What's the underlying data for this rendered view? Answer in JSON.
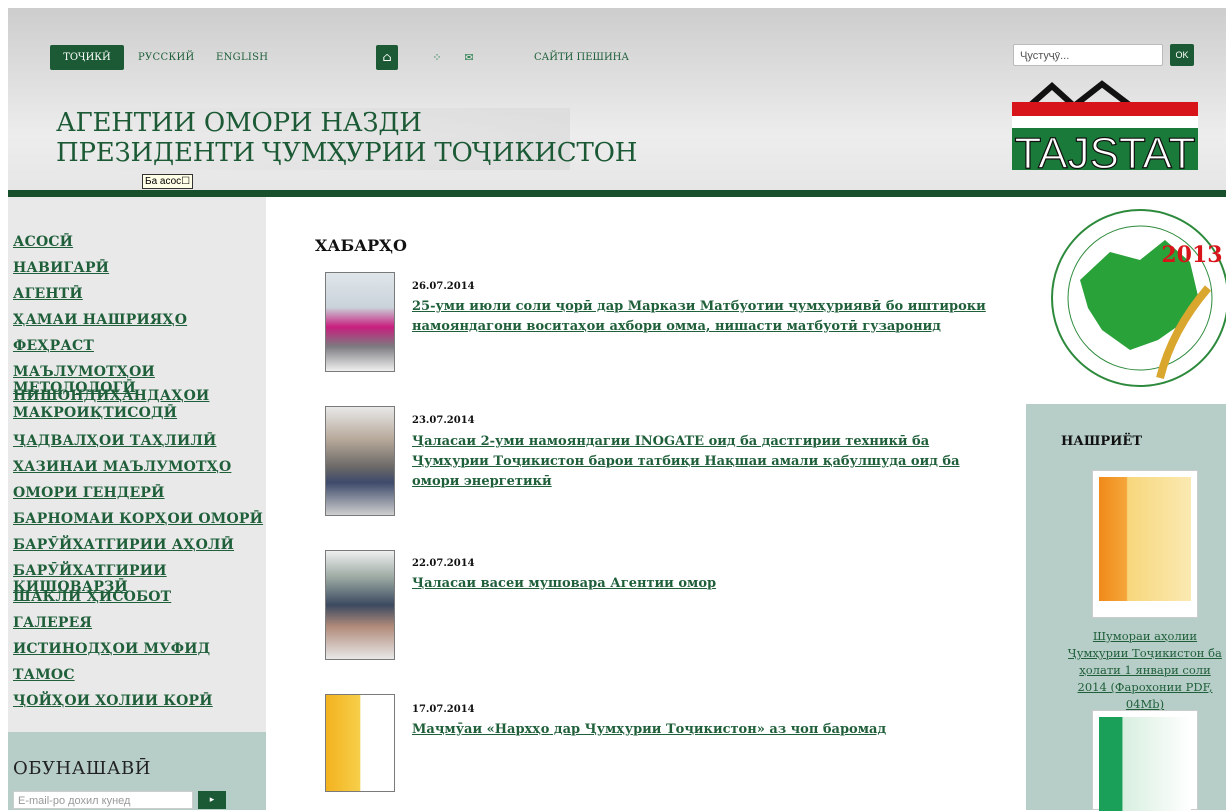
{
  "header": {
    "languages": [
      {
        "label": "ТОҶИКӢ",
        "active": true
      },
      {
        "label": "РУССКИЙ",
        "active": false
      },
      {
        "label": "ENGLISH",
        "active": false
      }
    ],
    "icons": [
      "home-icon",
      "sitemap-icon",
      "mail-icon"
    ],
    "old_site_label": "САЙТИ ПЕШИНА",
    "search": {
      "placeholder": "Ҷустуҷӯ...",
      "button_label": "OK"
    },
    "title_line1": "АГЕНТИИ ОМОРИ НАЗДИ",
    "title_line2": "ПРЕЗИДЕНТИ ҶУМҲУРИИ ТОҶИКИСТОН",
    "tooltip": "Ба асос",
    "logo_text": "TAJSTAT",
    "colors": {
      "brand_green": "#1b5a35",
      "logo_red": "#d7141a"
    }
  },
  "sidebar": {
    "items": [
      "АСОСӢ",
      "НАВИГАРӢ",
      "АГЕНТӢ",
      "ҲАМАИ НАШРИЯҲО",
      "ФЕҲРАСТ",
      "МАЪЛУМОТҲОИ МЕТОДОЛОГӢ",
      "НИШОНДИҲАНДАҲОИ МАКРОИҚТИСОДӢ",
      "ҶАДВАЛҲОИ ТАҲЛИЛӢ",
      "ХАЗИНАИ МАЪЛУМОТҲО",
      "ОМОРИ ГЕНДЕРӢ",
      "БАРНОМАИ КОРҲОИ ОМОРӢ",
      "БАРӮЙХАТГИРИИ АҲОЛӢ",
      "БАРӮЙХАТГИРИИ КИШОВАРЗӢ",
      "ШАКЛИ ҲИСОБОТ",
      "ГАЛЕРЕЯ",
      "ИСТИНОДҲОИ МУФИД",
      "ТАМОС",
      "ҶОЙҲОИ ХОЛИИ КОРӢ"
    ],
    "subscribe": {
      "heading": "ОБУНАШАВӢ",
      "email_placeholder": "E-mail-ро дохил кунед"
    }
  },
  "news": {
    "heading": "ХАБАРҲО",
    "items": [
      {
        "date": "26.07.2014",
        "title": "25-уми июли соли ҷорӣ дар Маркази Матбуотии ҷумҳуриявӣ бо иштироки намояндагони воситаҳои ахбори омма, нишасти матбуотӣ гузаронид"
      },
      {
        "date": "23.07.2014",
        "title": "Ҷаласаи 2-уми намояндагии INOGATE оид ба дастгирии техникӣ ба Ҷумҳурии Тоҷикистон барои татбиқи Нақшаи амали қабулшуда оид ба омори энергетикӣ"
      },
      {
        "date": "22.07.2014",
        "title": "Ҷаласаи васеи мушовара Агентии омор"
      },
      {
        "date": "17.07.2014",
        "title": "Маҷмӯаи «Нархҳо дар Ҷумҳурии Тоҷикистон» аз чоп баромад"
      }
    ]
  },
  "right": {
    "census_year": "2013",
    "publications_heading": "НАШРИЁТ",
    "publication_link": "Шумораи аҳолии Ҷумҳурии Тоҷикистон ба ҳолати 1 январи соли 2014 (Фарохонии PDF, 04Mb)"
  }
}
